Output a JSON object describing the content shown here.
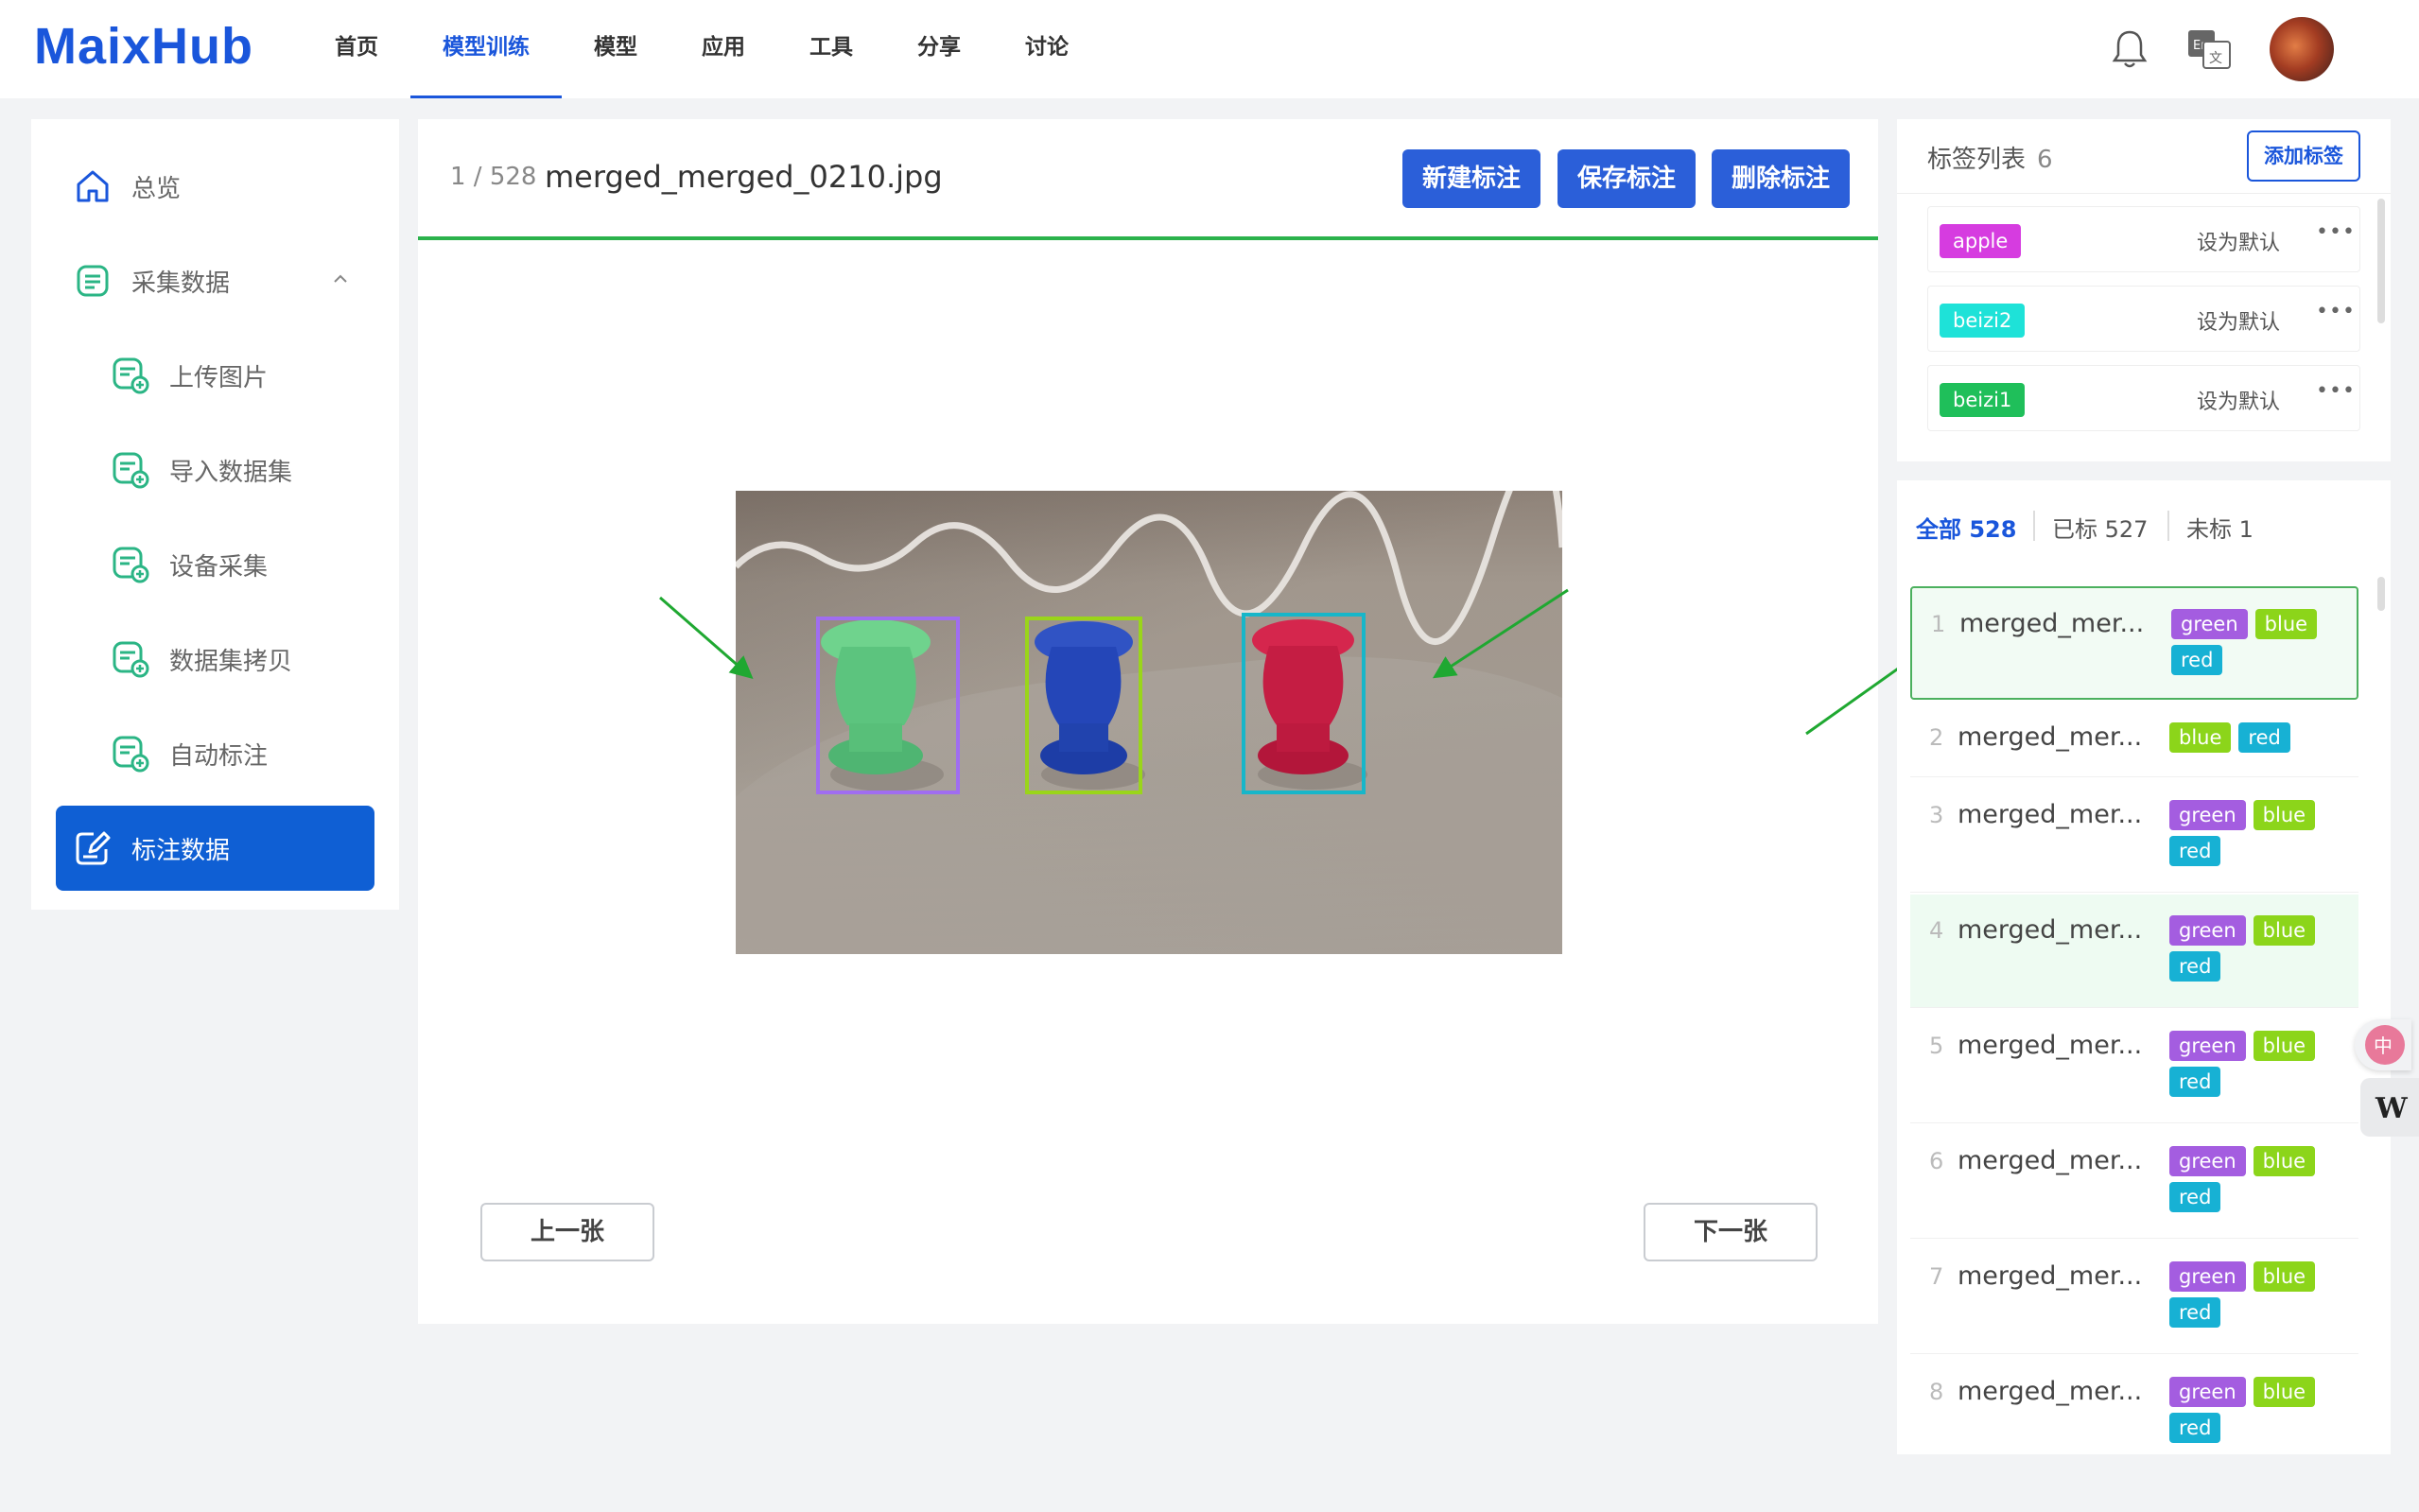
{
  "brand": {
    "logo": "MaixHub"
  },
  "nav": {
    "items": [
      "首页",
      "模型训练",
      "模型",
      "应用",
      "工具",
      "分享",
      "讨论"
    ],
    "active_index": 1
  },
  "sidebar": {
    "items": [
      {
        "label": "总览",
        "icon": "home-icon"
      },
      {
        "label": "采集数据",
        "icon": "data-collect-icon",
        "expanded": true
      },
      {
        "label": "上传图片",
        "icon": "upload-image-icon"
      },
      {
        "label": "导入数据集",
        "icon": "import-dataset-icon"
      },
      {
        "label": "设备采集",
        "icon": "device-collect-icon"
      },
      {
        "label": "数据集拷贝",
        "icon": "dataset-copy-icon"
      },
      {
        "label": "自动标注",
        "icon": "auto-annotate-icon"
      },
      {
        "label": "标注数据",
        "icon": "annotate-icon",
        "active": true
      }
    ]
  },
  "editor": {
    "counter": "1 / 528",
    "filename": "merged_merged_0210.jpg",
    "new_label": "新建标注",
    "save_label": "保存标注",
    "delete_label": "删除标注",
    "prev_label": "上一张",
    "next_label": "下一张",
    "boxes": [
      {
        "label": "green",
        "color": "#a06df0"
      },
      {
        "label": "blue",
        "color": "#9ad51a"
      },
      {
        "label": "red",
        "color": "#17b6c9"
      }
    ]
  },
  "label_list": {
    "title": "标签列表",
    "count": "6",
    "add_label": "添加标签",
    "set_default": "设为默认",
    "items": [
      {
        "name": "apple",
        "color": "#d63ce0"
      },
      {
        "name": "beizi2",
        "color": "#1ee2d8"
      },
      {
        "name": "beizi1",
        "color": "#1fbf5a"
      }
    ]
  },
  "image_list": {
    "filters": [
      {
        "label": "全部",
        "count": "528",
        "active": true
      },
      {
        "label": "已标",
        "count": "527"
      },
      {
        "label": "未标",
        "count": "1"
      }
    ],
    "tag_colors": {
      "green": "#a45de0",
      "blue": "#8cd51a",
      "red": "#17b1d4"
    },
    "rows": [
      {
        "index": "1",
        "name": "merged_mer...",
        "tags": [
          "green",
          "blue",
          "red"
        ],
        "selected": true
      },
      {
        "index": "2",
        "name": "merged_mer...",
        "tags": [
          "blue",
          "red"
        ]
      },
      {
        "index": "3",
        "name": "merged_mer...",
        "tags": [
          "green",
          "blue",
          "red"
        ]
      },
      {
        "index": "4",
        "name": "merged_mer...",
        "tags": [
          "green",
          "blue",
          "red"
        ],
        "hover": true
      },
      {
        "index": "5",
        "name": "merged_mer...",
        "tags": [
          "green",
          "blue",
          "red"
        ]
      },
      {
        "index": "6",
        "name": "merged_mer...",
        "tags": [
          "green",
          "blue",
          "red"
        ]
      },
      {
        "index": "7",
        "name": "merged_mer...",
        "tags": [
          "green",
          "blue",
          "red"
        ]
      },
      {
        "index": "8",
        "name": "merged_mer...",
        "tags": [
          "green",
          "blue",
          "red"
        ]
      }
    ]
  },
  "colors": {
    "accent": "#1a56db",
    "primary_button": "#2b5fd9",
    "success": "#2bb24c"
  }
}
